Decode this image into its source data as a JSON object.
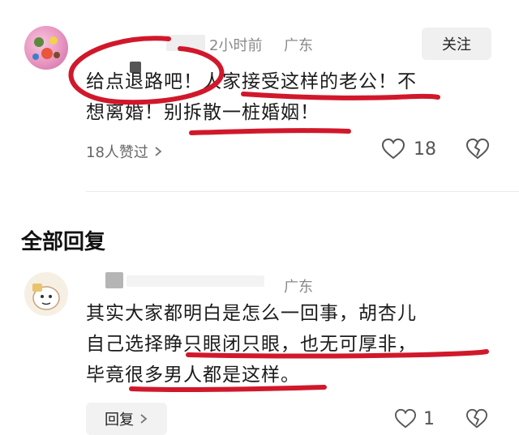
{
  "comment": {
    "time": "2小时前",
    "location": "广东",
    "follow_label": "关注",
    "line1": "给点退路吧！人家接受这样的老公！不",
    "line2": "想离婚！别拆散一桩婚姻！",
    "likers_text": "18人赞过",
    "like_count": "18"
  },
  "replies_section": {
    "title": "全部回复"
  },
  "reply": {
    "location": "广东",
    "line1": "其实大家都明白是怎么一回事，胡杏儿",
    "line2": "自己选择睁只眼闭只眼，也无可厚非，",
    "line3": "毕竟很多男人都是这样。",
    "reply_label": "回复",
    "like_count": "1"
  },
  "icons": {
    "like": "heart-outline-icon",
    "dislike": "heart-broken-outline-icon",
    "chevron": "chevron-right-icon"
  },
  "colors": {
    "annotation_ink": "#d1182b",
    "meta_gray": "#8a8a8a"
  }
}
